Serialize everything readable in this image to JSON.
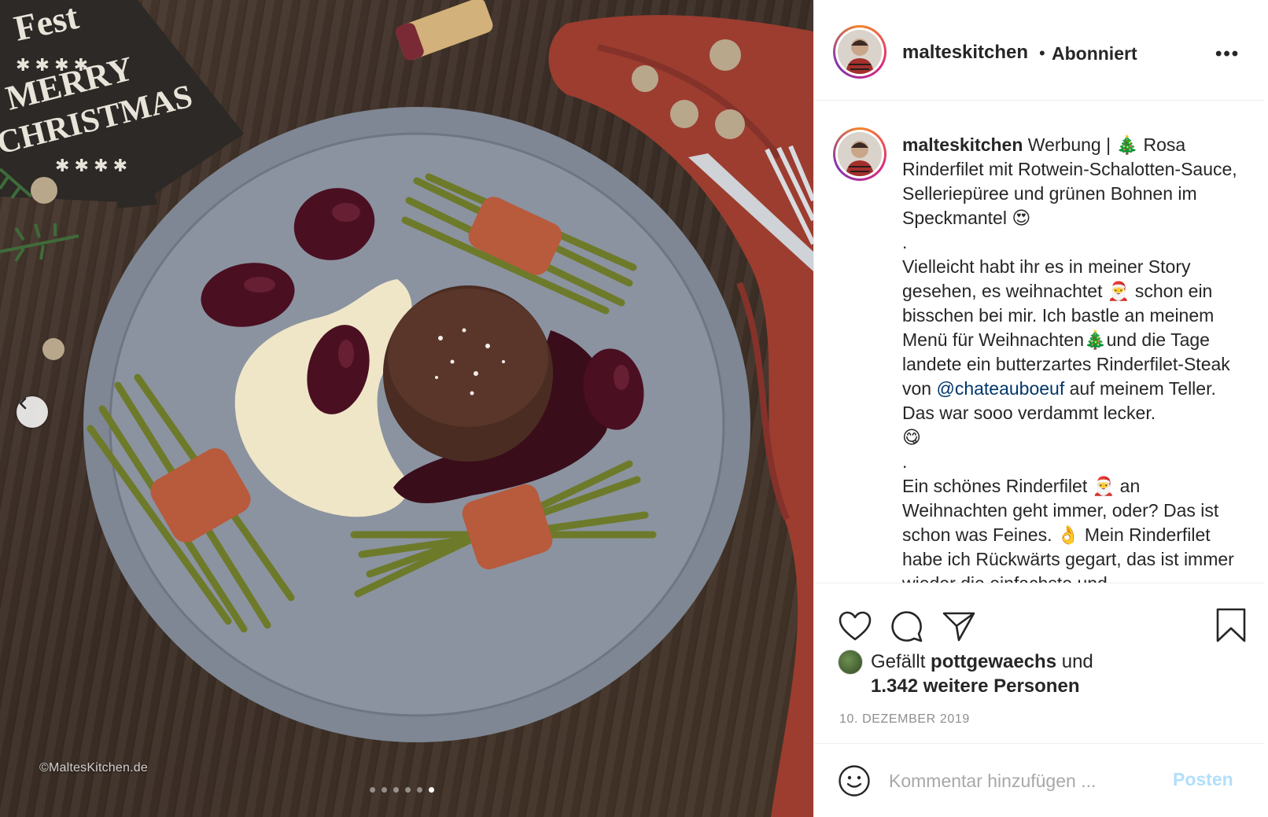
{
  "photo": {
    "sign_lines": [
      "Fest",
      "MERRY",
      "CHRISTMAS"
    ],
    "watermark": "©MaltesKitchen.de",
    "carousel": {
      "total": 6,
      "active": 6
    }
  },
  "header": {
    "username": "malteskitchen",
    "separator": "•",
    "follow_label": "Abonniert",
    "more": "•••"
  },
  "caption": {
    "username": "malteskitchen",
    "text_1": "Werbung | ",
    "emoji_tree": "🎄",
    "text_2": " Rosa Rinderfilet mit Rotwein-Schalotten-Sauce, Selleriepüree und grünen Bohnen im Speckmantel ",
    "emoji_hearteyes": "😍",
    "dot_1": ".",
    "para2_a": "Vielleicht habt ihr es in meiner Story gesehen, es weihnachtet ",
    "emoji_santa": "🎅",
    "para2_b": " schon ein bisschen bei mir. Ich bastle an meinem Menü für Weihnachten",
    "emoji_tree2": "🎄",
    "para2_c": "und die Tage landete ein butterzartes Rinderfilet-Steak von ",
    "mention": "@chateauboeuf",
    "para2_d": " auf meinem Teller. Das war sooo verdammt lecker.",
    "emoji_yum": "😋",
    "dot_2": ".",
    "para3_a": "Ein schönes Rinderfilet ",
    "emoji_hat": "🎅",
    "para3_b": " an Weihnachten geht immer, oder? Das ist schon was Feines. ",
    "emoji_ok": "👌",
    "para3_c": " Mein Rinderfilet habe ich Rückwärts gegart, das ist immer wieder die einfachste und"
  },
  "likes": {
    "prefix": "Gefällt ",
    "user": "pottgewaechs",
    "middle": " und",
    "count": "1.342 weitere Personen"
  },
  "date": "10. DEZEMBER 2019",
  "comment": {
    "placeholder": "Kommentar hinzufügen ...",
    "post_label": "Posten"
  },
  "icons": {
    "like": "heart-icon",
    "comment": "comment-icon",
    "share": "share-icon",
    "save": "bookmark-icon",
    "emoji": "smiley-icon",
    "prev": "chevron-left-icon"
  },
  "colors": {
    "link": "#00376b",
    "post_disabled": "#b2dffc",
    "muted": "#8e8e8e",
    "text": "#262626"
  }
}
